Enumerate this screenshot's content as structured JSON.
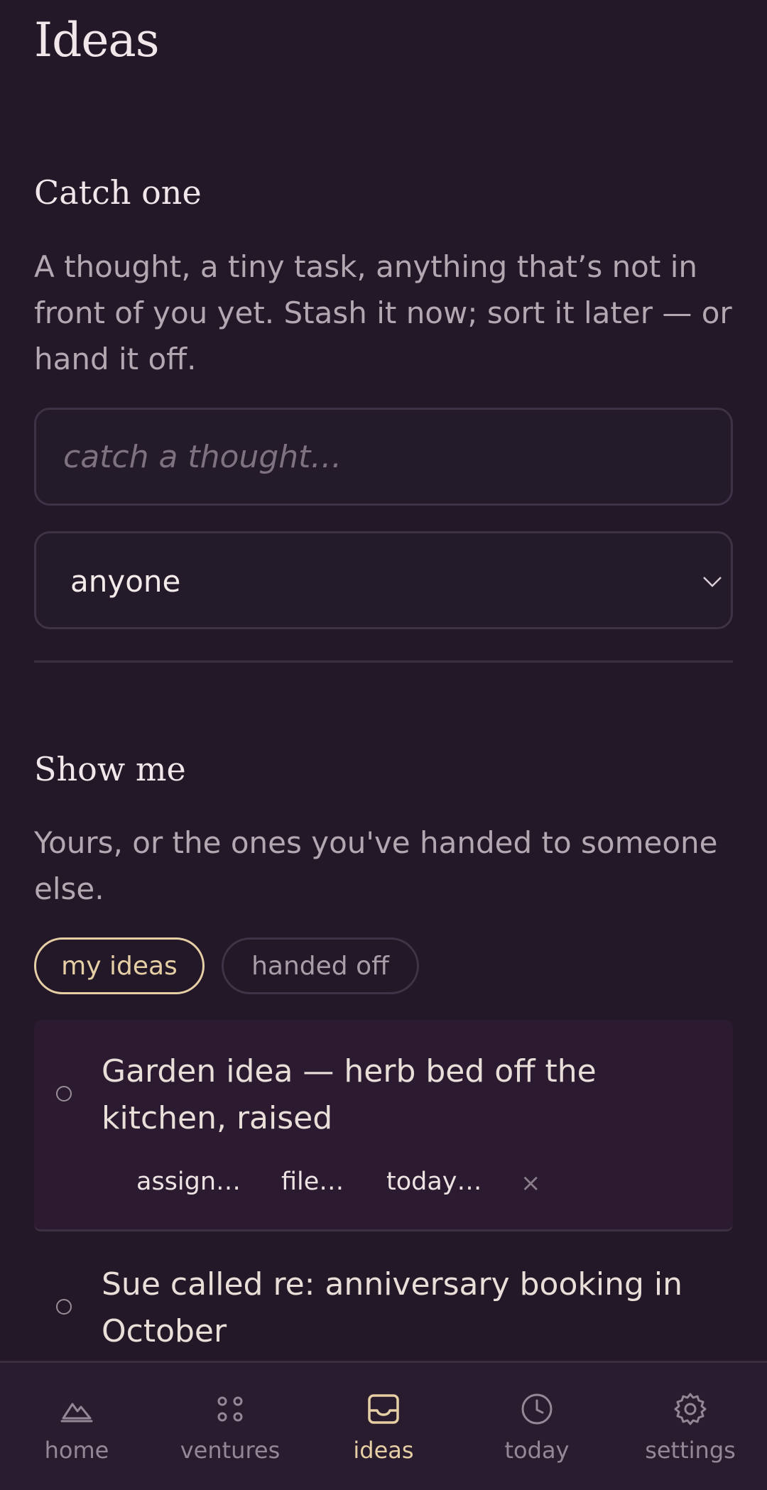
{
  "page": {
    "title": "Ideas"
  },
  "catch": {
    "title": "Catch one",
    "description": "A thought, a tiny task, anything that’s not in front of you yet. Stash it now; sort it later — or hand it off.",
    "input_placeholder": "catch a thought…",
    "assignee_value": "anyone"
  },
  "show": {
    "title": "Show me",
    "description": "Yours, or the ones you've handed to someone else.",
    "filters": [
      {
        "label": "my ideas",
        "active": true
      },
      {
        "label": "handed off",
        "active": false
      }
    ]
  },
  "ideas": [
    {
      "text": "Garden idea — herb bed off the kitchen, raised",
      "actions": [
        "assign…",
        "file…",
        "today…"
      ],
      "remove_glyph": "×"
    },
    {
      "text": "Sue called re: anniversary booking in October"
    }
  ],
  "nav": [
    {
      "label": "home",
      "icon": "mountain-icon",
      "active": false
    },
    {
      "label": "ventures",
      "icon": "dots-grid-icon",
      "active": false
    },
    {
      "label": "ideas",
      "icon": "inbox-icon",
      "active": true
    },
    {
      "label": "today",
      "icon": "clock-icon",
      "active": false
    },
    {
      "label": "settings",
      "icon": "gear-icon",
      "active": false
    }
  ],
  "colors": {
    "background": "#221828",
    "accent": "#e6cfa5",
    "card": "#2b1a30",
    "muted_text": "#b3a7b1"
  }
}
